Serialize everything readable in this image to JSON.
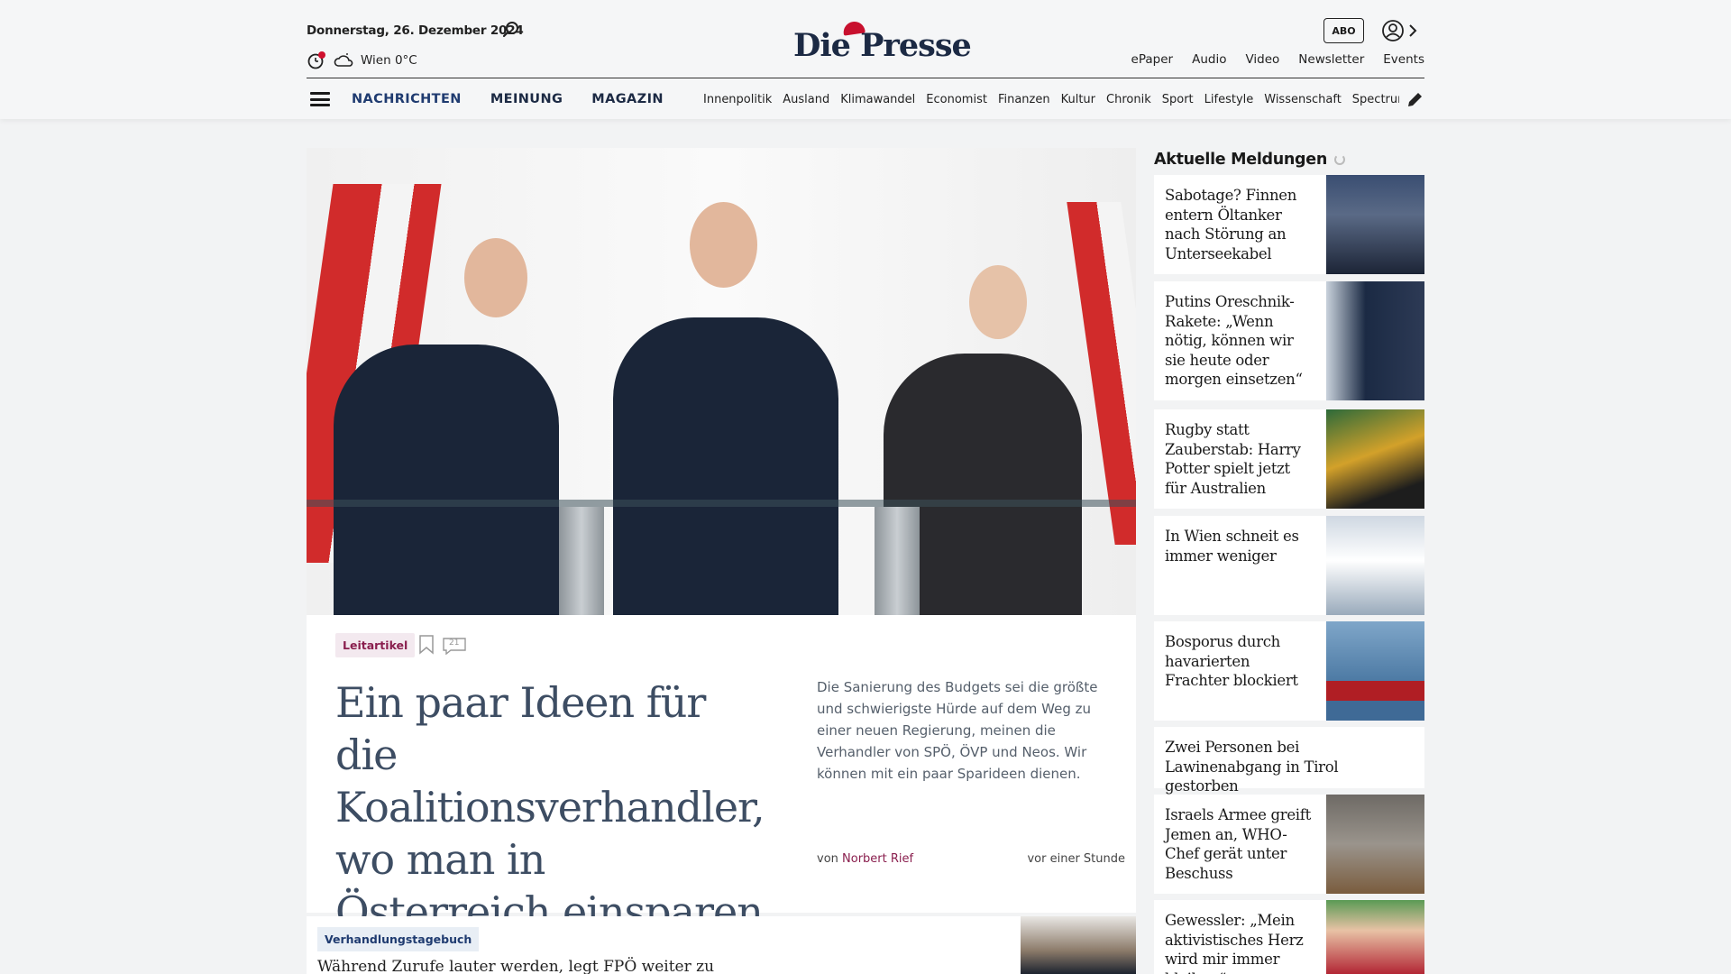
{
  "header": {
    "date": "Donnerstag, 26. Dezember 2024",
    "weather": "Wien 0°C",
    "logo": "Die Presse",
    "abo": "ABO",
    "top_links": [
      "ePaper",
      "Audio",
      "Video",
      "Newsletter",
      "Events"
    ]
  },
  "nav": {
    "main": [
      "NACHRICHTEN",
      "MEINUNG",
      "MAGAZIN"
    ],
    "sub": [
      "Innenpolitik",
      "Ausland",
      "Klimawandel",
      "Economist",
      "Finanzen",
      "Kultur",
      "Chronik",
      "Sport",
      "Lifestyle",
      "Wissenschaft",
      "Spectrum"
    ]
  },
  "hero": {
    "tag": "Leitartikel",
    "comment_count": "21",
    "headline": "Ein paar Ideen für die Koalitionsverhandler, wo man in Österreich einsparen kann",
    "teaser": "Die Sanierung des Budgets sei die größte und schwierigste Hürde auf dem Weg zu einer neuen Regierung, meinen die Verhandler von SPÖ, ÖVP und Neos. Wir können mit ein paar Sparideen dienen.",
    "byline_prefix": "von",
    "author": "Norbert Rief",
    "time": "vor einer Stunde"
  },
  "second_article": {
    "tag": "Verhandlungstagebuch",
    "title": "Während Zurufe lauter werden, legt FPÖ weiter zu"
  },
  "sidebar": {
    "title": "Aktuelle Meldungen",
    "items": [
      {
        "title": "Sabotage? Finnen entern Öltanker nach Störung an Unterseekabel"
      },
      {
        "title": "Putins Oreschnik-Rakete: „Wenn nötig, können wir sie heute oder morgen einsetzen“"
      },
      {
        "title": "Rugby statt Zauberstab: Harry Potter spielt jetzt für Australien"
      },
      {
        "title": "In Wien schneit es immer weniger"
      },
      {
        "title": "Bosporus durch havarierten Frachter blockiert"
      },
      {
        "title": "Zwei Personen bei Lawinenabgang in Tirol gestorben"
      },
      {
        "title": "Israels Armee greift Jemen an, WHO-Chef gerät unter Beschuss"
      },
      {
        "title": "Gewessler: „Mein aktivistisches Herz wird mir immer bleiben“"
      }
    ]
  },
  "colors": {
    "brand_navy": "#1c2a44",
    "brand_red": "#c8102e",
    "tag_magenta": "#8a1f4e"
  }
}
